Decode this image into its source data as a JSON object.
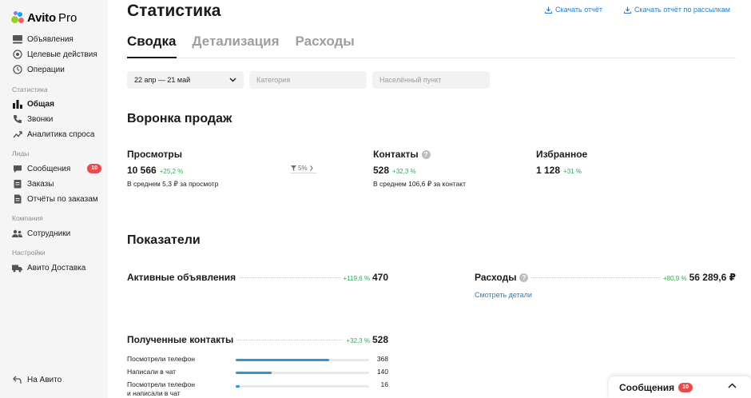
{
  "logo": {
    "brand": "Avito",
    "suffix": "Pro"
  },
  "sidebar": {
    "items_top": [
      {
        "label": "Объявления",
        "icon": "list-icon"
      },
      {
        "label": "Целевые действия",
        "icon": "target-icon"
      },
      {
        "label": "Операции",
        "icon": "history-icon"
      }
    ],
    "sections": {
      "stats": "Статистика",
      "leads": "Лиды",
      "company": "Компания",
      "settings": "Настройки"
    },
    "stats_items": [
      {
        "label": "Общая",
        "icon": "bar-chart-icon",
        "active": true
      },
      {
        "label": "Звонки",
        "icon": "phone-icon"
      },
      {
        "label": "Аналитика спроса",
        "icon": "trend-icon"
      }
    ],
    "leads_items": [
      {
        "label": "Сообщения",
        "icon": "chat-icon",
        "badge": "10"
      },
      {
        "label": "Заказы",
        "icon": "orders-icon"
      },
      {
        "label": "Отчёты по заказам",
        "icon": "report-icon"
      }
    ],
    "company_items": [
      {
        "label": "Сотрудники",
        "icon": "people-icon"
      }
    ],
    "settings_items": [
      {
        "label": "Авито Доставка",
        "icon": "truck-icon"
      }
    ],
    "back": {
      "label": "На Авито",
      "icon": "arrow-back-icon"
    }
  },
  "header": {
    "title": "Статистика",
    "download_report": "Скачать отчёт",
    "download_mailing": "Скачать отчёт по рассылкам"
  },
  "tabs": [
    "Сводка",
    "Детализация",
    "Расходы"
  ],
  "filters": {
    "date": "22 апр — 21 май",
    "category_placeholder": "Категория",
    "location_placeholder": "Населённый пункт"
  },
  "funnel": {
    "title": "Воронка продаж",
    "views": {
      "label": "Просмотры",
      "value": "10 566",
      "delta": "+25,2 %",
      "sub": "В среднем 5,3 ₽ за просмотр"
    },
    "conversion": "5%",
    "contacts": {
      "label": "Контакты",
      "value": "528",
      "delta": "+32,3 %",
      "sub": "В среднем 106,6 ₽ за контакт"
    },
    "favorites": {
      "label": "Избранное",
      "value": "1 128",
      "delta": "+31 %"
    }
  },
  "metrics": {
    "title": "Показатели",
    "active_ads": {
      "label": "Активные объявления",
      "delta": "+119,6 %",
      "value": "470"
    },
    "expenses": {
      "label": "Расходы",
      "delta": "+80,9 %",
      "value": "56 289,6 ₽",
      "link": "Смотреть детали"
    },
    "contacts": {
      "label": "Полученные контакты",
      "delta": "+32,3 %",
      "value": "528",
      "rows": [
        {
          "label": "Посмотрели телефон",
          "value": "368",
          "fraction": 0.7
        },
        {
          "label": "Написали в чат",
          "value": "140",
          "fraction": 0.27
        },
        {
          "label": "Посмотрели телефон\nи написали в чат",
          "value": "16",
          "fraction": 0.03
        }
      ]
    }
  },
  "chat_widget": {
    "title": "Сообщения",
    "badge": "10"
  },
  "colors": {
    "accent_blue": "#2e7cc0",
    "positive": "#35a85a",
    "badge_red": "#e84b4b",
    "bar_blue": "#2f95dc"
  }
}
